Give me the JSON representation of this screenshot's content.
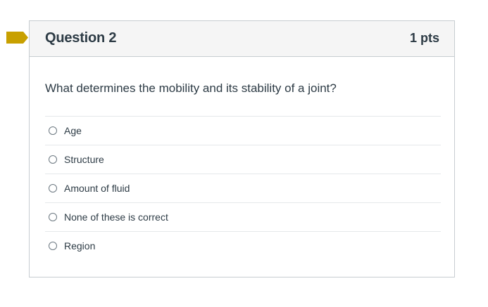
{
  "flag": {
    "icon": "bookmark-flag-icon",
    "color": "#c8a000"
  },
  "question": {
    "title": "Question 2",
    "points": "1 pts",
    "text": "What determines the mobility and its stability of a joint?",
    "answers": [
      {
        "label": "Age",
        "selected": false
      },
      {
        "label": "Structure",
        "selected": false
      },
      {
        "label": "Amount of fluid",
        "selected": false
      },
      {
        "label": "None of these is correct",
        "selected": false
      },
      {
        "label": "Region",
        "selected": false
      }
    ]
  }
}
